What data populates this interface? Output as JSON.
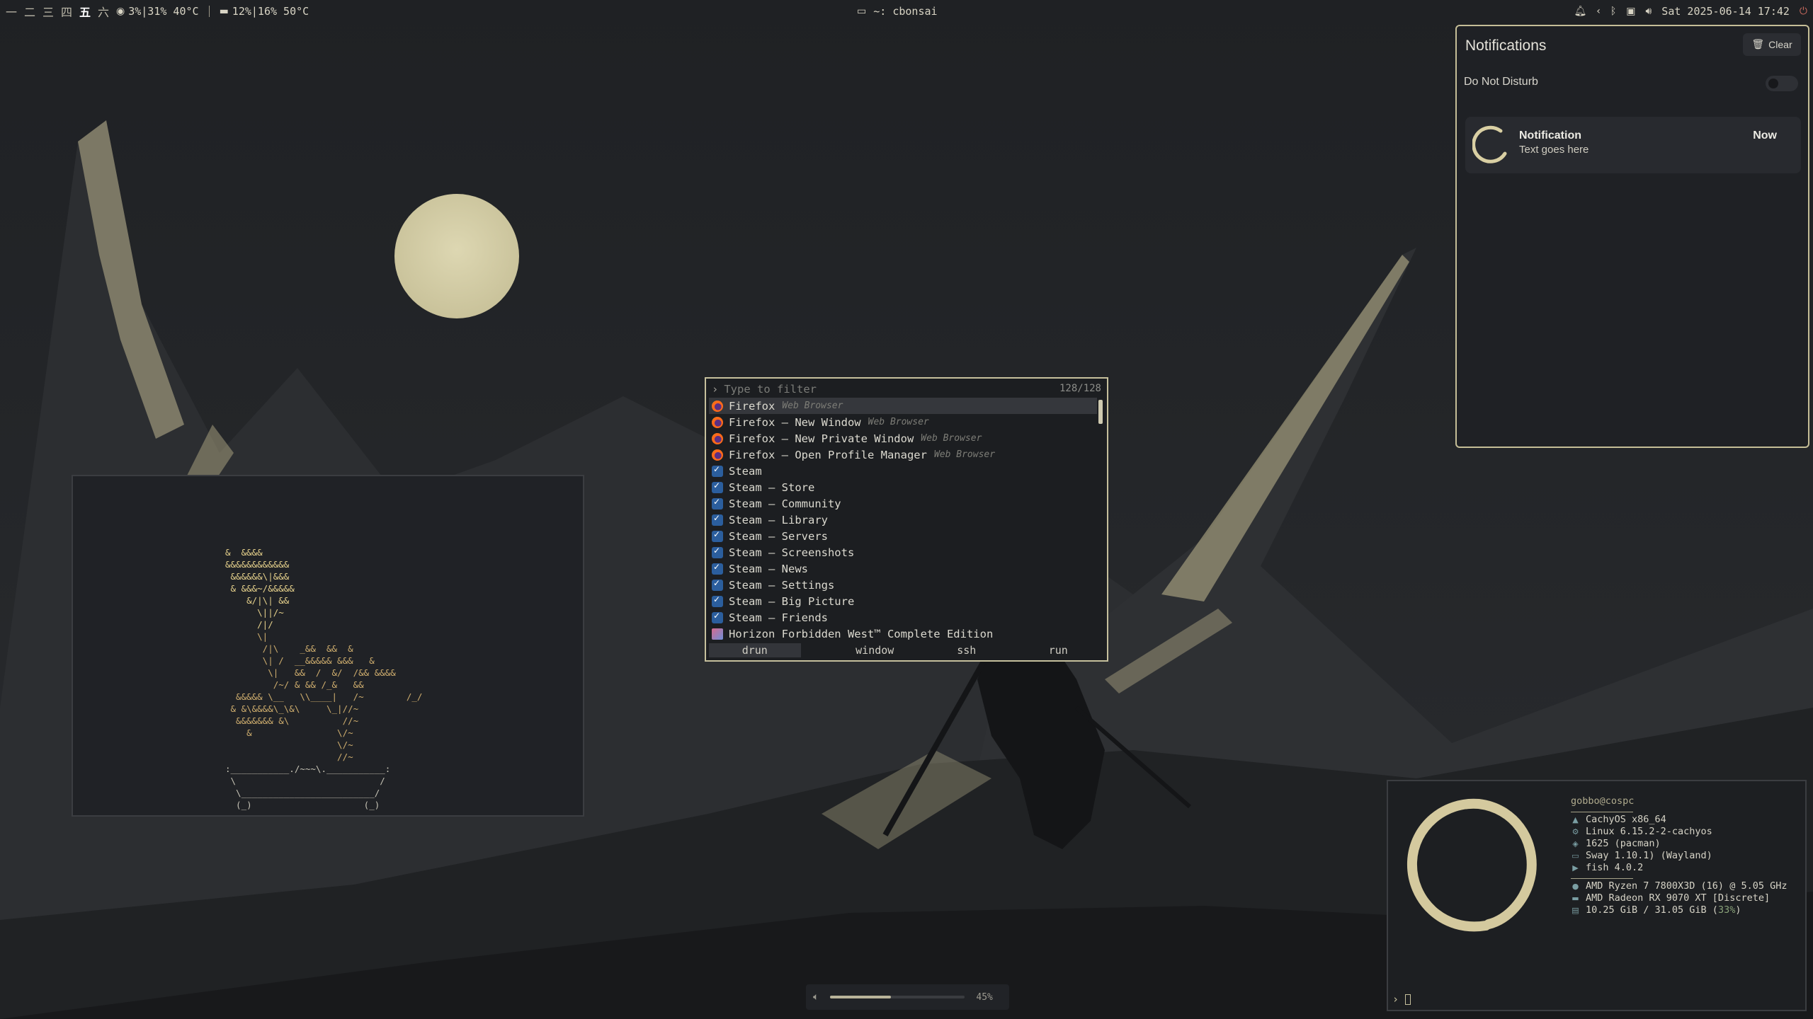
{
  "topbar": {
    "workspaces": [
      {
        "label": "一",
        "active": false
      },
      {
        "label": "二",
        "active": false
      },
      {
        "label": "三",
        "active": false
      },
      {
        "label": "四",
        "active": false
      },
      {
        "label": "五",
        "active": true
      },
      {
        "label": "六",
        "active": false
      }
    ],
    "cpu": "3%|31% 40°C",
    "gpu": "12%|16% 50°C",
    "window_title": "~: cbonsai",
    "datetime": "Sat 2025-06-14 17:42"
  },
  "notifications": {
    "title": "Notifications",
    "clear_label": "Clear",
    "dnd_label": "Do Not Disturb",
    "dnd_enabled": false,
    "items": [
      {
        "title": "Notification",
        "body": "Text goes here",
        "time": "Now"
      }
    ]
  },
  "launcher": {
    "placeholder": "Type to filter",
    "count": "128/128",
    "items": [
      {
        "name": "Firefox",
        "desc": "Web Browser",
        "icon": "firefox-icon",
        "selected": true
      },
      {
        "name": "Firefox – New Window",
        "desc": "Web Browser",
        "icon": "firefox-icon"
      },
      {
        "name": "Firefox – New Private Window",
        "desc": "Web Browser",
        "icon": "firefox-icon"
      },
      {
        "name": "Firefox – Open Profile Manager",
        "desc": "Web Browser",
        "icon": "firefox-icon"
      },
      {
        "name": "Steam",
        "desc": "",
        "icon": "steam-icon"
      },
      {
        "name": "Steam – Store",
        "desc": "",
        "icon": "steam-icon"
      },
      {
        "name": "Steam – Community",
        "desc": "",
        "icon": "steam-icon"
      },
      {
        "name": "Steam – Library",
        "desc": "",
        "icon": "steam-icon"
      },
      {
        "name": "Steam – Servers",
        "desc": "",
        "icon": "steam-icon"
      },
      {
        "name": "Steam – Screenshots",
        "desc": "",
        "icon": "steam-icon"
      },
      {
        "name": "Steam – News",
        "desc": "",
        "icon": "steam-icon"
      },
      {
        "name": "Steam – Settings",
        "desc": "",
        "icon": "steam-icon"
      },
      {
        "name": "Steam – Big Picture",
        "desc": "",
        "icon": "steam-icon"
      },
      {
        "name": "Steam – Friends",
        "desc": "",
        "icon": "steam-icon"
      },
      {
        "name": "Horizon Forbidden West™ Complete Edition",
        "desc": "",
        "icon": "horizon-icon"
      }
    ],
    "modes": [
      {
        "label": "drun",
        "active": true
      },
      {
        "label": "window",
        "active": false
      },
      {
        "label": "ssh",
        "active": false
      },
      {
        "label": "run",
        "active": false
      }
    ]
  },
  "fastfetch": {
    "user": "gobbo@cospc",
    "os_rows": [
      {
        "icon": "arch-icon",
        "text": "CachyOS x86_64"
      },
      {
        "icon": "kernel-icon",
        "text": "Linux 6.15.2-2-cachyos"
      },
      {
        "icon": "package-icon",
        "text": "1625 (pacman)"
      },
      {
        "icon": "window-icon",
        "text": "Sway 1.10.1) (Wayland)"
      },
      {
        "icon": "shell-icon",
        "text": "fish 4.0.2"
      }
    ],
    "hw_rows": [
      {
        "icon": "cpu-icon",
        "text": "AMD Ryzen 7 7800X3D (16) @ 5.05 GHz"
      },
      {
        "icon": "gpu-icon",
        "text": "AMD Radeon RX 9070 XT [Discrete]"
      }
    ],
    "memory_text": "10.25 GiB / 31.05 GiB (",
    "memory_pct": "33%",
    "memory_close": ")"
  },
  "volume": {
    "percent": 45,
    "label": "45%"
  },
  "bonsai_art": [
    "&  &&&&",
    "&&&&&&&&&&&&",
    " &&&&&&\\|&&&",
    " & &&&~/&&&&&",
    "    &/|\\| &&",
    "      \\||/~",
    "      /|/",
    "      \\|",
    "       /|\\    _&&  &&  &",
    "       \\| /  __&&&&& &&&   &",
    "        \\|   &&  /  &/  /&& &&&&",
    "         /~/ & && /_&   &&",
    "  &&&&& \\__   \\\\____|   /~        /_/",
    " & &\\&&&&\\_\\&\\     \\_|//~",
    "  &&&&&&& &\\          //~",
    "    &                \\/~",
    "                     \\/~",
    "                     //~",
    ":___________./~~~\\.___________:",
    " \\                           /",
    "  \\_________________________/",
    "  (_)                     (_)"
  ]
}
